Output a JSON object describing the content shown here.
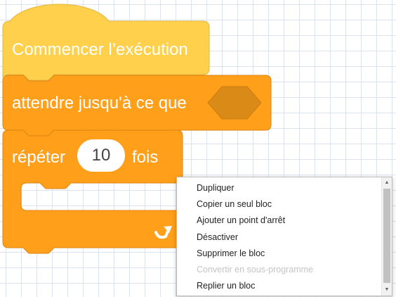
{
  "blocks": {
    "hat_label": "Commencer l’exécution",
    "wait_label": "attendre jusqu'à ce que",
    "repeat_label": "répéter",
    "repeat_count": "10",
    "repeat_suffix": "fois",
    "colors": {
      "hat_fill": "#ffd04b",
      "hat_stroke": "#e6b63c",
      "control_fill": "#ff9f1a",
      "control_stroke": "#db8614",
      "hexagon_fill": "#d98a17"
    }
  },
  "context_menu": {
    "items": [
      {
        "label": "Dupliquer",
        "enabled": true
      },
      {
        "label": "Copier un seul bloc",
        "enabled": true
      },
      {
        "label": "Ajouter un point d'arrêt",
        "enabled": true
      },
      {
        "label": "Désactiver",
        "enabled": true
      },
      {
        "label": "Supprimer le bloc",
        "enabled": true
      },
      {
        "label": "Convertir en sous-programme",
        "enabled": false
      },
      {
        "label": "Replier un bloc",
        "enabled": true
      }
    ]
  }
}
